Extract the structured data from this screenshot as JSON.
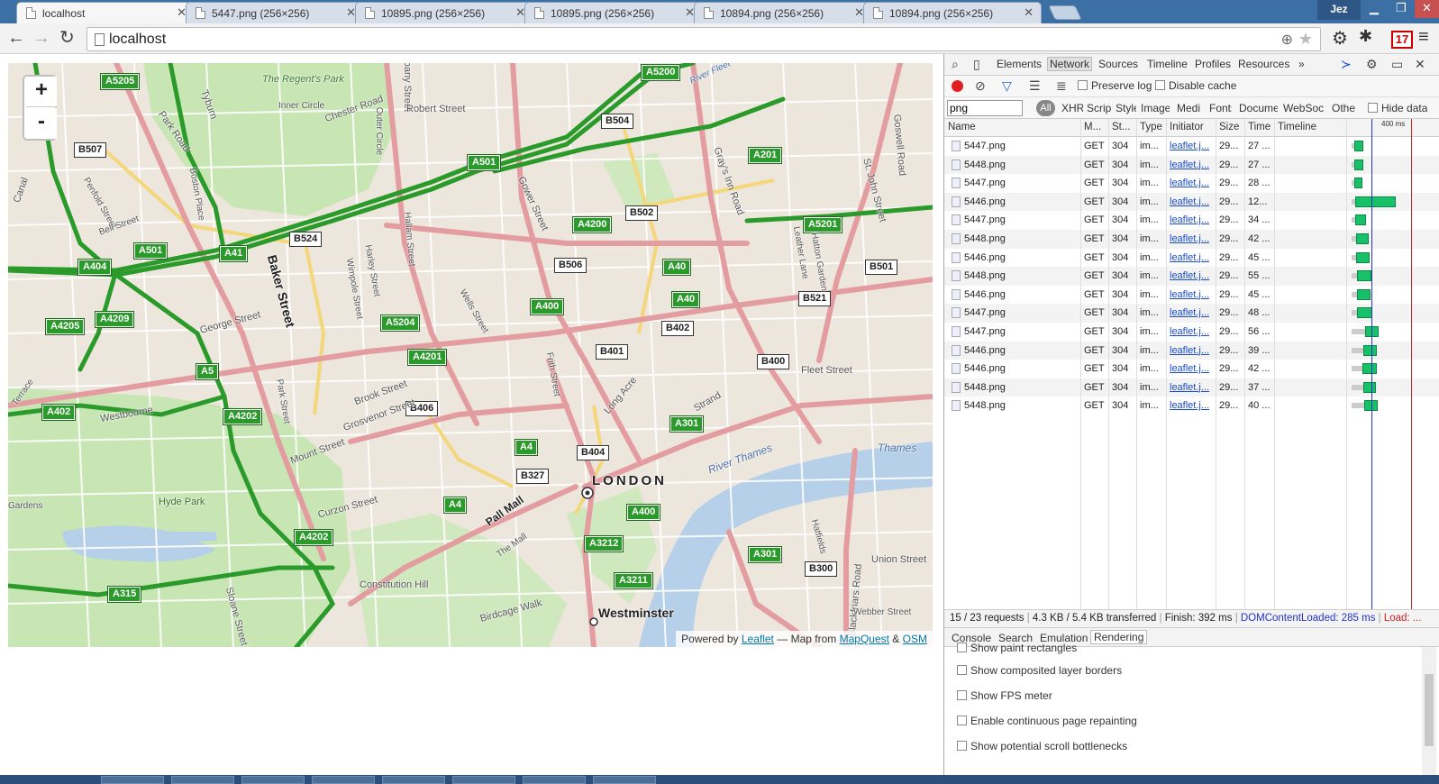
{
  "browser": {
    "tabs": [
      {
        "title": "localhost",
        "active": true
      },
      {
        "title": "5447.png (256×256)"
      },
      {
        "title": "10895.png (256×256)"
      },
      {
        "title": "10895.png (256×256)"
      },
      {
        "title": "10894.png (256×256)"
      },
      {
        "title": "10894.png (256×256)"
      }
    ],
    "user": "Jez",
    "url": "localhost",
    "gmail_badge": "17"
  },
  "map": {
    "zoom_in": "+",
    "zoom_out": "-",
    "city_label": "LONDON",
    "district_labels": [
      "Westminster"
    ],
    "road_labels": {
      "a_roads": [
        "A5205",
        "A5200",
        "A501",
        "A201",
        "A4200",
        "A5201",
        "A41",
        "A404",
        "A501",
        "A4209",
        "A4205",
        "A5204",
        "A400",
        "A40",
        "A40",
        "A4201",
        "A5",
        "A402",
        "A4202",
        "A4",
        "A301",
        "A4",
        "A400",
        "A3212",
        "A4202",
        "A3211",
        "A315",
        "A301"
      ],
      "b_roads": [
        "B507",
        "B504",
        "B502",
        "B524",
        "B506",
        "B501",
        "B521",
        "B402",
        "B401",
        "B400",
        "B406",
        "B404",
        "B327",
        "B300"
      ]
    },
    "street_labels": [
      "Park Road",
      "The Regent's Park",
      "Inner Circle",
      "Chester Road",
      "Outer Circle",
      "Albany Street",
      "Robert Street",
      "Gower Street",
      "Gray's Inn Road",
      "Goswell Road",
      "St. John Street",
      "Tyburn",
      "Boston Place",
      "Penfold Street",
      "Bell Street",
      "Baker Street",
      "Harley Street",
      "Wimpole Street",
      "Hallam Street",
      "Wells Street",
      "Leather Lane",
      "Hatton Garden",
      "George Street",
      "Brook Street",
      "Grosvenor Street",
      "Frith Street",
      "Long Acre",
      "Strand",
      "Fleet Street",
      "Mount Street",
      "Park Street",
      "Westbourne",
      "Hyde Park",
      "Curzon Street",
      "Pall Mall",
      "The Mall",
      "Constitution Hill",
      "Birdcage Walk",
      "Blackfriars Road",
      "Hatfields",
      "Union Street",
      "Webber Street",
      "Sloane Street",
      "Canal",
      "Gardens",
      "Terrace"
    ],
    "water_labels": [
      "River Thames",
      "Thames",
      "River Fleet"
    ],
    "attribution": {
      "prefix": "Powered by",
      "leaflet": "Leaflet",
      "middle": "— Map from",
      "mapquest": "MapQuest",
      "amp": "&",
      "osm": "OSM"
    }
  },
  "devtools": {
    "tabs": [
      "Elements",
      "Network",
      "Sources",
      "Timeline",
      "Profiles",
      "Resources",
      "»"
    ],
    "selected_tab": "Network",
    "preserve_log": "Preserve log",
    "disable_cache": "Disable cache",
    "filter_value": "png",
    "filter_types": [
      "All",
      "XHR",
      "Scripts",
      "Styles",
      "Images",
      "Media",
      "Fonts",
      "Documents",
      "WebSockets",
      "Other"
    ],
    "hide_data": "Hide data",
    "columns": [
      "Name",
      "M...",
      "St...",
      "Type",
      "Initiator",
      "Size",
      "Time",
      "Timeline"
    ],
    "timeline_marker": "400 ms",
    "requests": [
      {
        "name": "5447.png",
        "method": "GET",
        "status": "304",
        "type": "im...",
        "initiator": "leaflet.j...",
        "size": "29...",
        "time": "27 ...",
        "wait_ms": 7,
        "bar_ms": 27
      },
      {
        "name": "5448.png",
        "method": "GET",
        "status": "304",
        "type": "im...",
        "initiator": "leaflet.j...",
        "size": "29...",
        "time": "27 ...",
        "wait_ms": 8,
        "bar_ms": 27
      },
      {
        "name": "5447.png",
        "method": "GET",
        "status": "304",
        "type": "im...",
        "initiator": "leaflet.j...",
        "size": "29...",
        "time": "28 ...",
        "wait_ms": 9,
        "bar_ms": 22
      },
      {
        "name": "5446.png",
        "method": "GET",
        "status": "304",
        "type": "im...",
        "initiator": "leaflet.j...",
        "size": "29...",
        "time": "12...",
        "wait_ms": 10,
        "bar_ms": 120
      },
      {
        "name": "5447.png",
        "method": "GET",
        "status": "304",
        "type": "im...",
        "initiator": "leaflet.j...",
        "size": "29...",
        "time": "34 ...",
        "wait_ms": 11,
        "bar_ms": 30
      },
      {
        "name": "5448.png",
        "method": "GET",
        "status": "304",
        "type": "im...",
        "initiator": "leaflet.j...",
        "size": "29...",
        "time": "42 ...",
        "wait_ms": 12,
        "bar_ms": 38
      },
      {
        "name": "5446.png",
        "method": "GET",
        "status": "304",
        "type": "im...",
        "initiator": "leaflet.j...",
        "size": "29...",
        "time": "45 ...",
        "wait_ms": 13,
        "bar_ms": 40
      },
      {
        "name": "5448.png",
        "method": "GET",
        "status": "304",
        "type": "im...",
        "initiator": "leaflet.j...",
        "size": "29...",
        "time": "55 ...",
        "wait_ms": 15,
        "bar_ms": 42
      },
      {
        "name": "5446.png",
        "method": "GET",
        "status": "304",
        "type": "im...",
        "initiator": "leaflet.j...",
        "size": "29...",
        "time": "45 ...",
        "wait_ms": 16,
        "bar_ms": 40
      },
      {
        "name": "5447.png",
        "method": "GET",
        "status": "304",
        "type": "im...",
        "initiator": "leaflet.j...",
        "size": "29...",
        "time": "48 ...",
        "wait_ms": 17,
        "bar_ms": 44
      },
      {
        "name": "5447.png",
        "method": "GET",
        "status": "304",
        "type": "im...",
        "initiator": "leaflet.j...",
        "size": "29...",
        "time": "56 ...",
        "wait_ms": 40,
        "bar_ms": 40
      },
      {
        "name": "5446.png",
        "method": "GET",
        "status": "304",
        "type": "im...",
        "initiator": "leaflet.j...",
        "size": "29...",
        "time": "39 ...",
        "wait_ms": 35,
        "bar_ms": 38
      },
      {
        "name": "5446.png",
        "method": "GET",
        "status": "304",
        "type": "im...",
        "initiator": "leaflet.j...",
        "size": "29...",
        "time": "42 ...",
        "wait_ms": 32,
        "bar_ms": 42
      },
      {
        "name": "5448.png",
        "method": "GET",
        "status": "304",
        "type": "im...",
        "initiator": "leaflet.j...",
        "size": "29...",
        "time": "37 ...",
        "wait_ms": 34,
        "bar_ms": 36
      },
      {
        "name": "5448.png",
        "method": "GET",
        "status": "304",
        "type": "im...",
        "initiator": "leaflet.j...",
        "size": "29...",
        "time": "40 ...",
        "wait_ms": 36,
        "bar_ms": 40
      }
    ],
    "status": {
      "requests": "15 / 23 requests",
      "transferred": "4.3 KB / 5.4 KB transferred",
      "finish": "Finish: 392 ms",
      "dcl": "DOMContentLoaded: 285 ms",
      "load": "Load: ..."
    },
    "drawer_tabs": [
      "Console",
      "Search",
      "Emulation",
      "Rendering"
    ],
    "selected_drawer_tab": "Rendering",
    "rendering_options": [
      "Show paint rectangles",
      "Show composited layer borders",
      "Show FPS meter",
      "Enable continuous page repainting",
      "Show potential scroll bottlenecks"
    ]
  },
  "colors": {
    "a_road": "#2a9a2a",
    "major_road": "#e39da0",
    "park": "#c8e6b4",
    "water": "#b5d0e8",
    "land": "#ece6dc",
    "accent_link": "#1a4cc9",
    "dcl_blue": "#2233cc",
    "load_red": "#cc2222"
  }
}
